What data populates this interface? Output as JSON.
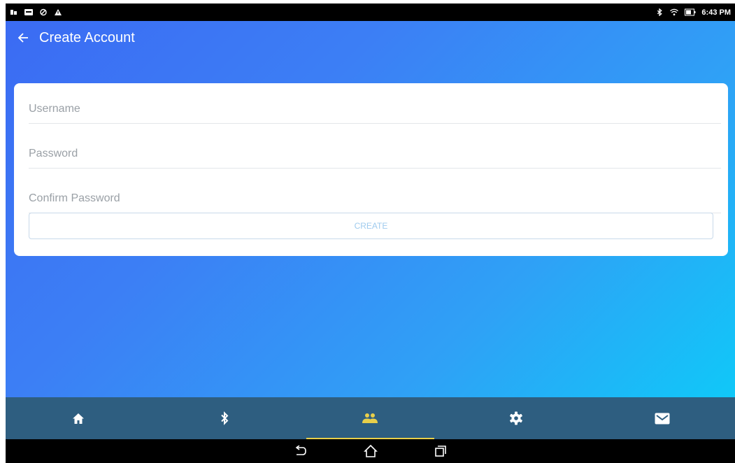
{
  "status_bar": {
    "time": "6:43 PM",
    "left_icons": [
      "notification-app-icon",
      "media-icon",
      "sync-icon",
      "warning-icon"
    ],
    "right_icons": [
      "bluetooth-icon",
      "wifi-icon",
      "battery-icon"
    ]
  },
  "app_bar": {
    "title": "Create Account",
    "back_icon": "back-arrow-icon"
  },
  "form": {
    "username": {
      "placeholder": "Username",
      "value": ""
    },
    "password": {
      "placeholder": "Password",
      "value": ""
    },
    "confirm_password": {
      "placeholder": "Confirm Password",
      "value": ""
    },
    "create_label": "CREATE"
  },
  "tabs": [
    {
      "icon": "home-icon",
      "active": false
    },
    {
      "icon": "bluetooth-icon",
      "active": false
    },
    {
      "icon": "people-icon",
      "active": true
    },
    {
      "icon": "gear-icon",
      "active": false
    },
    {
      "icon": "mail-icon",
      "active": false
    }
  ],
  "colors": {
    "gradient_start": "#3b6bf3",
    "gradient_end": "#10c8f8",
    "tab_bar": "#2e5e80",
    "active_tab_accent": "#e8cf4a",
    "button_text": "#9fcbee"
  },
  "system_nav": [
    "back-nav-icon",
    "home-nav-icon",
    "recents-nav-icon"
  ]
}
